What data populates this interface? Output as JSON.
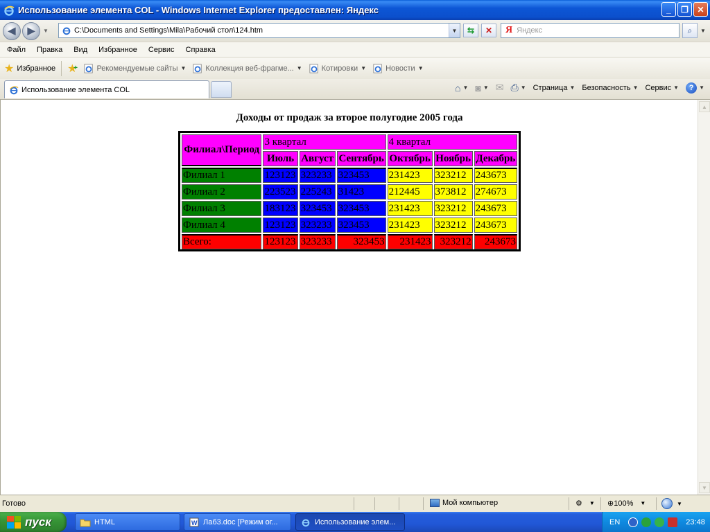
{
  "window": {
    "title": "Использование элемента COL - Windows Internet Explorer предоставлен: Яндекс",
    "minimize": "_",
    "maximize": "❐",
    "close": "✕"
  },
  "address": {
    "url": "C:\\Documents and Settings\\Mila\\Рабочий стол\\124.htm",
    "search_placeholder": "Яндекс",
    "search_logo": "Я"
  },
  "menu": [
    "Файл",
    "Правка",
    "Вид",
    "Избранное",
    "Сервис",
    "Справка"
  ],
  "favorites": {
    "label": "Избранное",
    "links": [
      "Рекомендуемые сайты",
      "Коллекция веб-фрагме...",
      "Котировки",
      "Новости"
    ]
  },
  "tabs": {
    "active_label": "Использование элемента COL"
  },
  "command_bar": {
    "page": "Страница",
    "safety": "Безопасность",
    "tools": "Сервис",
    "help": "?"
  },
  "page": {
    "caption": "Доходы от продаж за второе полугодие 2005 года",
    "corner": "Филиал\\Период",
    "quarters": [
      "3 квартал",
      "4 квартал"
    ],
    "months": [
      "Июль",
      "Август",
      "Сентябрь",
      "Октябрь",
      "Ноябрь",
      "Декабрь"
    ],
    "rows": [
      {
        "branch": "Филиал 1",
        "values": [
          "123123",
          "323233",
          "323453",
          "231423",
          "323212",
          "243673"
        ]
      },
      {
        "branch": "Филиал 2",
        "values": [
          "223523",
          "225243",
          "31423",
          "212445",
          "373812",
          "274673"
        ]
      },
      {
        "branch": "Филиал 3",
        "values": [
          "183123",
          "323453",
          "323453",
          "231423",
          "323212",
          "243673"
        ]
      },
      {
        "branch": "Филиал 4",
        "values": [
          "123123",
          "323233",
          "323453",
          "231423",
          "323212",
          "243673"
        ]
      }
    ],
    "total": {
      "label": "Всего:",
      "values": [
        "123123",
        "323233",
        "323453",
        "231423",
        "323212",
        "243673"
      ]
    },
    "colors": {
      "header": "#ff00ff",
      "branch": "#008000",
      "q3": "#0000ff",
      "q4": "#ffff00",
      "total": "#ff0000"
    }
  },
  "status": {
    "text": "Готово",
    "zone": "Мой компьютер",
    "zoom": "100%"
  },
  "taskbar": {
    "start": "пуск",
    "tasks": [
      "HTML",
      "Лаб3.doc [Режим ог...",
      "Использование элем..."
    ],
    "lang": "EN",
    "clock": "23:48"
  }
}
